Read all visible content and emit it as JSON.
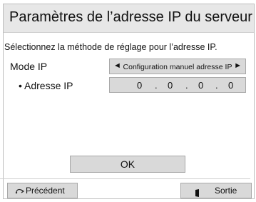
{
  "dialog": {
    "title": "Paramètres de l’adresse IP du serveur",
    "instruction": "Sélectionnez la méthode de réglage pour l’adresse IP."
  },
  "ip_mode": {
    "label": "Mode IP",
    "value": "Configuration manuel adresse IP",
    "prev_arrow": "◄",
    "next_arrow": "►"
  },
  "ip_address": {
    "label": "• Adresse IP",
    "octets": [
      "0",
      "0",
      "0",
      "0"
    ],
    "separator": "."
  },
  "ok_button": {
    "label": "OK"
  },
  "footer": {
    "back": {
      "label": "Précédent",
      "icon": "return-arrow-icon"
    },
    "exit": {
      "label": "Sortie",
      "icon": "exit-door-icon"
    }
  },
  "colors": {
    "title_bar": "#e7e7e7",
    "field_bg": "#d9d9d9",
    "border": "#a8a8a8"
  }
}
